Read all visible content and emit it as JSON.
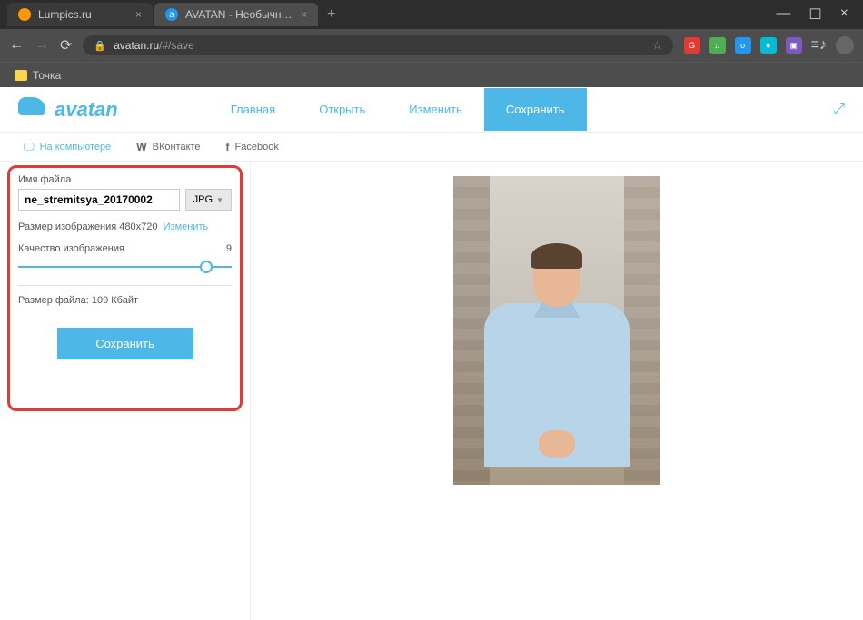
{
  "browser": {
    "tabs": [
      {
        "title": "Lumpics.ru",
        "favicon": "orange"
      },
      {
        "title": "AVATAN - Необычный Фоторед",
        "favicon": "blue"
      }
    ],
    "url_prefix": "avatan.ru",
    "url_path": "/#/save",
    "bookmark": "Точка"
  },
  "header": {
    "logo_text": "avatan",
    "nav": {
      "home": "Главная",
      "open": "Открыть",
      "change": "Изменить",
      "save": "Сохранить"
    }
  },
  "sub_tabs": {
    "computer": "На компьютере",
    "vk": "ВКонтакте",
    "facebook": "Facebook"
  },
  "sidebar": {
    "filename_label": "Имя файла",
    "filename_value": "ne_stremitsya_20170002",
    "format": "JPG",
    "size_label": "Размер изображения",
    "size_value": "480x720",
    "change_link": "Изменить",
    "quality_label": "Качество изображения",
    "quality_value": "9",
    "filesize_label": "Размер файла:",
    "filesize_value": "109 Кбайт",
    "save_button": "Сохранить"
  }
}
